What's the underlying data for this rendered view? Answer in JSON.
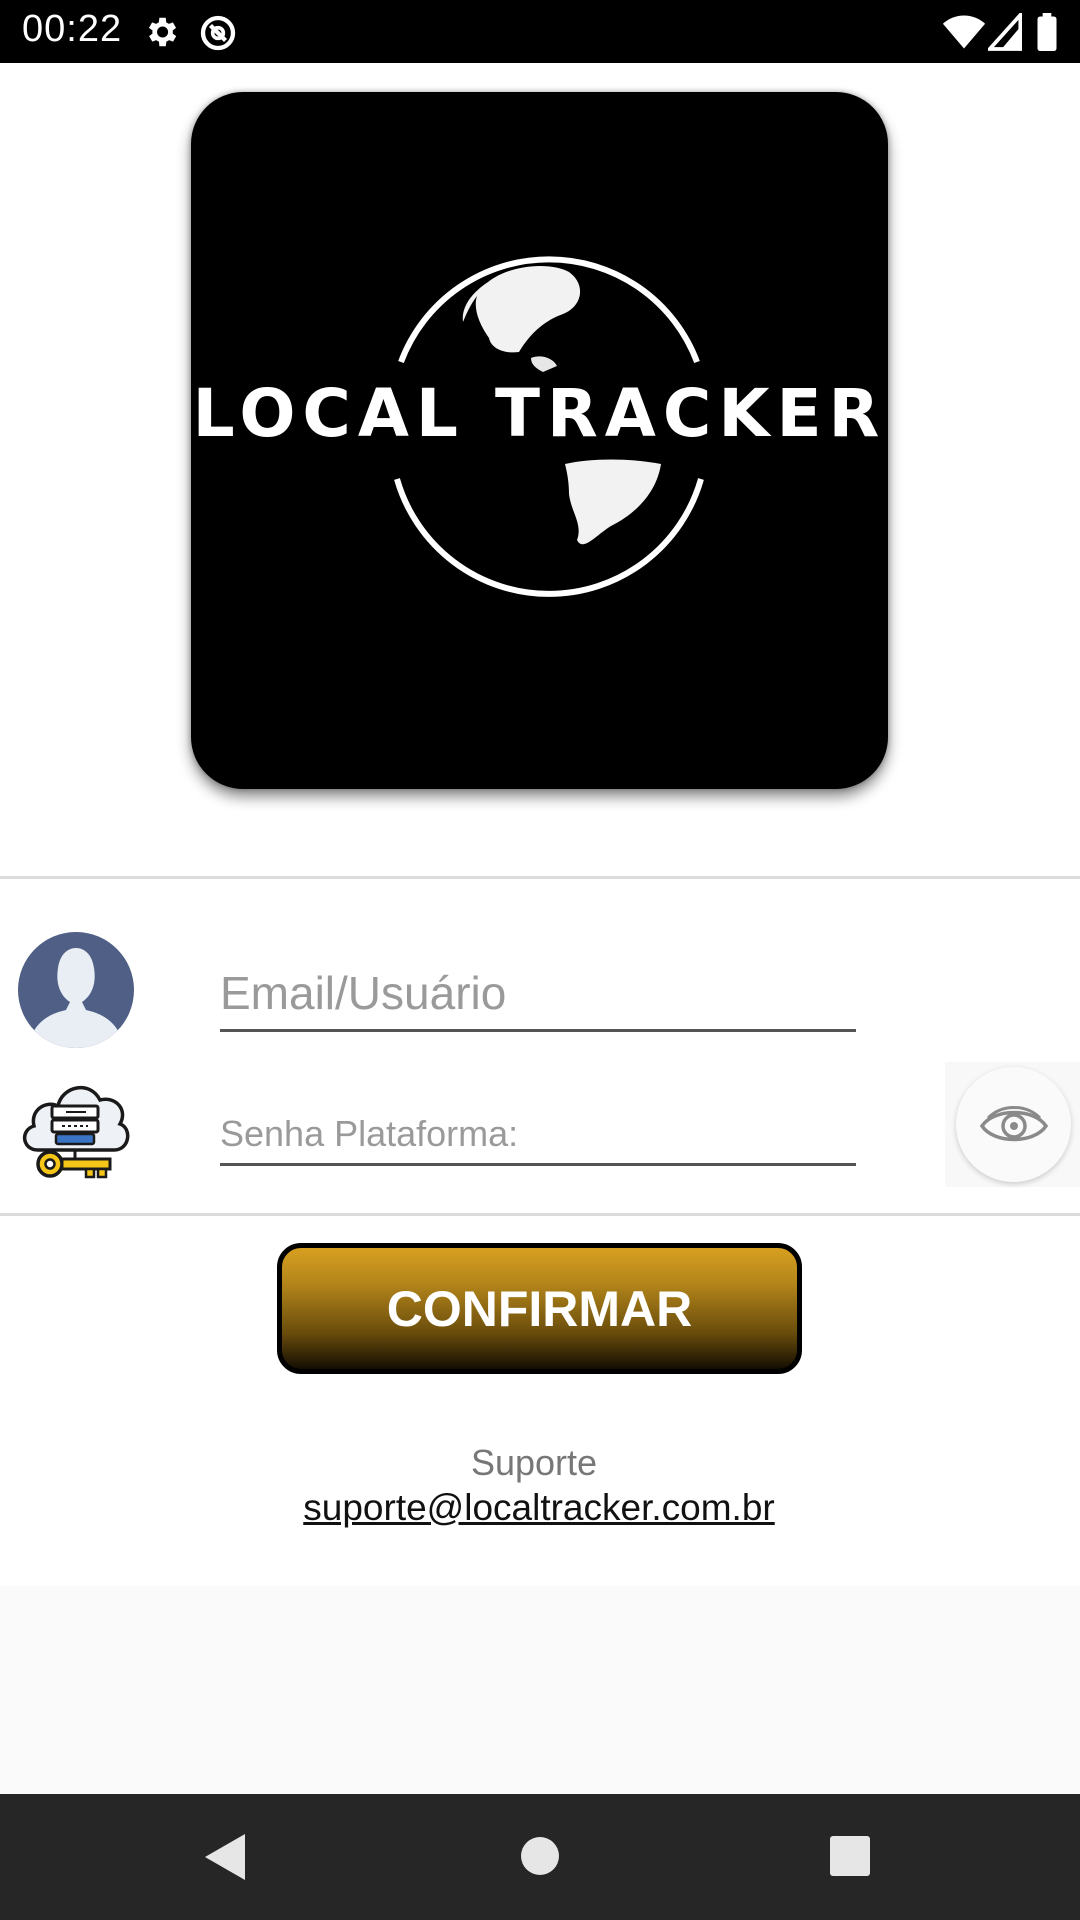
{
  "status_bar": {
    "time": "00:22",
    "icons": [
      "gear-icon",
      "do-not-disturb-icon",
      "wifi-icon",
      "signal-icon",
      "battery-icon"
    ]
  },
  "logo": {
    "text": "LOCAL TRACKER",
    "colors": {
      "background": "#000000",
      "foreground": "#ffffff"
    }
  },
  "login_form": {
    "email": {
      "placeholder": "Email/Usuário",
      "value": "",
      "icon": "user-avatar-icon"
    },
    "password": {
      "placeholder": "Senha Plataforma:",
      "value": "",
      "icon": "cloud-key-icon"
    },
    "toggle_visibility_icon": "eye-icon"
  },
  "confirm_button": {
    "label": "CONFIRMAR",
    "colors": {
      "gradient_top": "#d8a020",
      "gradient_bottom": "#130d02",
      "border": "#000000"
    }
  },
  "support": {
    "label": "Suporte",
    "email": "suporte@localtracker.com.br"
  },
  "nav_bar": {
    "buttons": [
      "back-icon",
      "home-icon",
      "recents-icon"
    ]
  }
}
